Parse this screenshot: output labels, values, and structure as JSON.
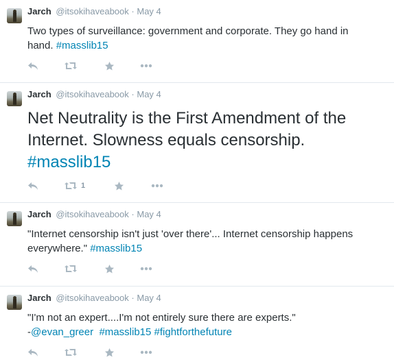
{
  "tweets": [
    {
      "name": "Jarch",
      "handle": "@itsokihaveabook",
      "separator": "·",
      "date": "May 4",
      "text_line1": "Two types of surveillance: government and corporate. They go hand in",
      "text_line2_plain": "hand. ",
      "hashtags": [
        "#masslib15"
      ]
    },
    {
      "name": "Jarch",
      "handle": "@itsokihaveabook",
      "separator": "·",
      "date": "May 4",
      "text_line1": "Net Neutrality is the First Amendment of the",
      "text_line2_plain": "Internet. Slowness equals censorship.",
      "hashtags": [
        "#masslib15"
      ],
      "retweet_count": "1"
    },
    {
      "name": "Jarch",
      "handle": "@itsokihaveabook",
      "separator": "·",
      "date": "May 4",
      "text_line1": "\"Internet censorship isn't just 'over there'... Internet censorship happens",
      "text_line2_plain": "everywhere.\" ",
      "hashtags": [
        "#masslib15"
      ]
    },
    {
      "name": "Jarch",
      "handle": "@itsokihaveabook",
      "separator": "·",
      "date": "May 4",
      "text_line1": "\"I'm not an expert....I'm not entirely sure there are experts.\"",
      "text_line2_plain": "-",
      "mention": "@evan_greer",
      "hashtags": [
        "#masslib15",
        "#fightforthefuture"
      ]
    }
  ],
  "icons": [
    "reply-icon",
    "retweet-icon",
    "favorite-icon",
    "more-icon"
  ],
  "colors": {
    "link": "#0084b4",
    "icon": "#aab8c2",
    "meta": "#8899a6",
    "divider": "#e1e8ed"
  }
}
